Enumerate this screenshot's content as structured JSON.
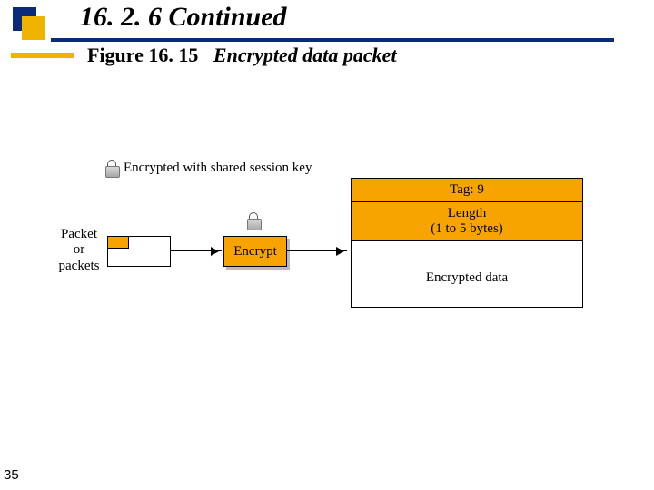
{
  "header": {
    "section": "16. 2. 6  Continued",
    "figure_prefix": "Figure 16. 15",
    "figure_caption": "Encrypted data packet"
  },
  "legend": {
    "text": "Encrypted with shared session key"
  },
  "packet": {
    "label_line1": "Packet",
    "label_line2": "or",
    "label_line3": "packets"
  },
  "encrypt": {
    "label": "Encrypt"
  },
  "table": {
    "tag": "Tag: 9",
    "length": "Length\n(1 to 5 bytes)",
    "body": "Encrypted data"
  },
  "page": "35"
}
